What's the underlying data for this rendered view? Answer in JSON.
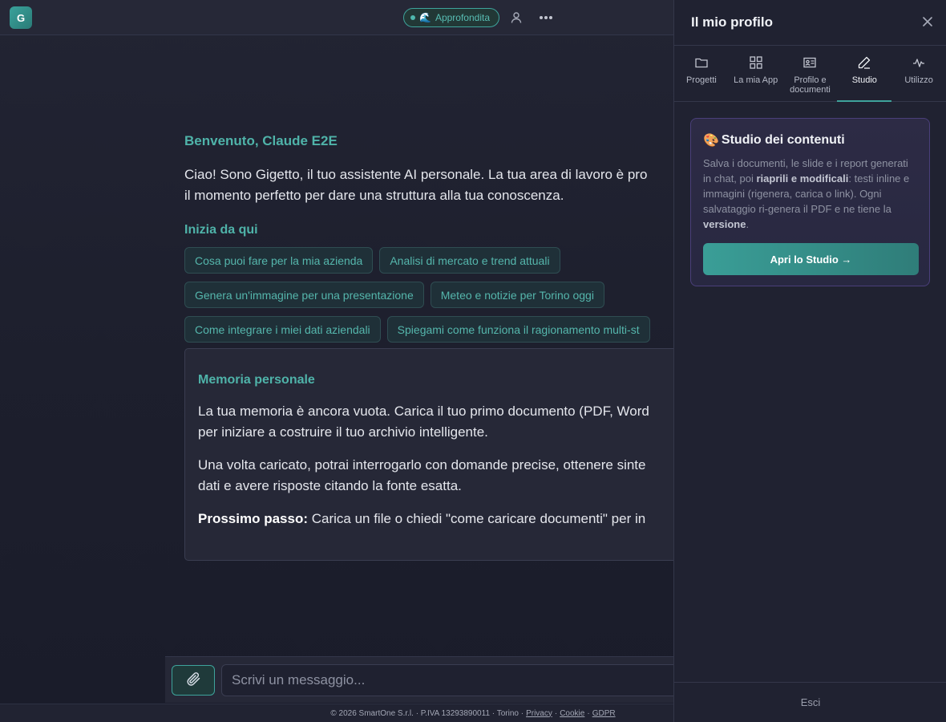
{
  "header": {
    "logo_letter": "G",
    "mode_label": "Approfondita",
    "mode_emoji": "🌊"
  },
  "main": {
    "welcome_title": "Benvenuto, Claude E2E",
    "intro_line1": "Ciao! Sono Gigetto, il tuo assistente AI personale. La tua area di lavoro è pro",
    "intro_line2": "il momento perfetto per dare una struttura alla tua conoscenza.",
    "start_title": "Inizia da qui",
    "chips": [
      "Cosa puoi fare per la mia azienda",
      "Analisi di mercato e trend attuali",
      "Genera un'immagine per una presentazione",
      "Meteo e notizie per Torino oggi",
      "Come integrare i miei dati aziendali",
      "Spiegami come funziona il ragionamento multi-st"
    ],
    "memory": {
      "title": "Memoria personale",
      "p1_line1": "La tua memoria è ancora vuota. Carica il tuo primo documento (PDF, Word",
      "p1_line2": "per iniziare a costruire il tuo archivio intelligente.",
      "p2_line1": "Una volta caricato, potrai interrogarlo con domande precise, ottenere sinte",
      "p2_line2": "dati e avere risposte citando la fonte esatta.",
      "next_label": "Prossimo passo:",
      "next_text": " Carica un file o chiedi \"come caricare documenti\" per in"
    }
  },
  "composer": {
    "placeholder": "Scrivi un messaggio..."
  },
  "footer": {
    "copyright": "© 2026 SmartOne S.r.l. · P.IVA 13293890011 · Torino ·",
    "links": [
      "Privacy",
      "Cookie",
      "GDPR"
    ],
    "sep": "·"
  },
  "panel": {
    "title": "Il mio profilo",
    "tabs": [
      {
        "label": "Progetti",
        "icon": "folder-icon"
      },
      {
        "label": "La mia App",
        "icon": "grid-icon"
      },
      {
        "label": "Profilo e documenti",
        "icon": "id-card-icon"
      },
      {
        "label": "Studio",
        "icon": "pencil-icon"
      },
      {
        "label": "Utilizzo",
        "icon": "activity-icon"
      }
    ],
    "active_tab": "Studio",
    "studio": {
      "emoji": "🎨",
      "title": "Studio dei contenuti",
      "desc_a": "Salva i documenti, le slide e i report generati in chat, poi ",
      "desc_b": "riaprili e modificali",
      "desc_c": ": testi inline e immagini (rigenera, carica o link). Ogni salvataggio ri-genera il PDF e ne tiene la ",
      "desc_d": "versione",
      "desc_e": ".",
      "button": "Apri lo Studio →"
    },
    "logout": "Esci"
  },
  "colors": {
    "accent": "#3ea39b",
    "background": "#1d1f2d",
    "panel": "#202231"
  }
}
